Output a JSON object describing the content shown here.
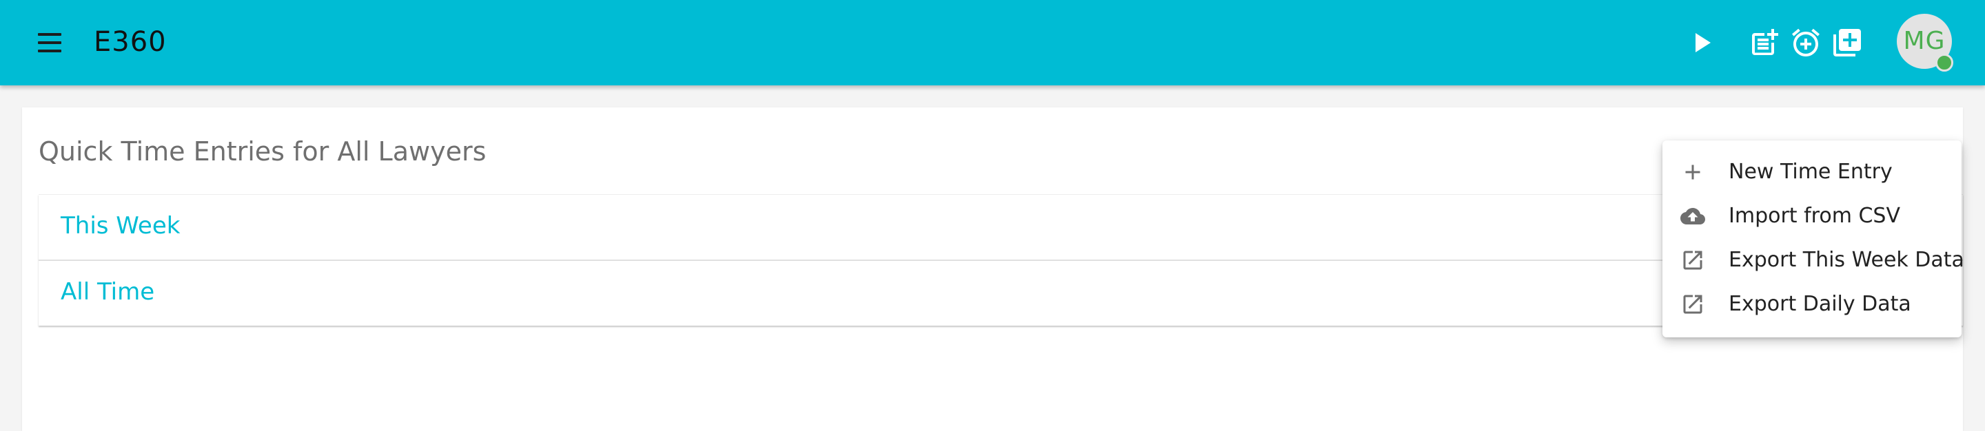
{
  "app": {
    "title": "E360",
    "user_initials": "MG"
  },
  "toolbar": {
    "icons": [
      "menu-icon",
      "play-icon",
      "post-add-icon",
      "add-alarm-icon",
      "library-add-icon"
    ]
  },
  "card": {
    "title": "Quick Time Entries for All Lawyers",
    "rows": [
      "This Week",
      "All Time"
    ]
  },
  "menu": {
    "items": [
      {
        "label": "New Time Entry",
        "icon": "add-icon"
      },
      {
        "label": "Import from CSV",
        "icon": "cloud-upload-icon"
      },
      {
        "label": "Export This Week Data",
        "icon": "open-in-new-icon"
      },
      {
        "label": "Export Daily Data",
        "icon": "open-in-new-icon"
      }
    ]
  },
  "colors": {
    "primary": "#00bcd4",
    "avatar_text": "#4caf50",
    "status_online": "#4caf50"
  }
}
